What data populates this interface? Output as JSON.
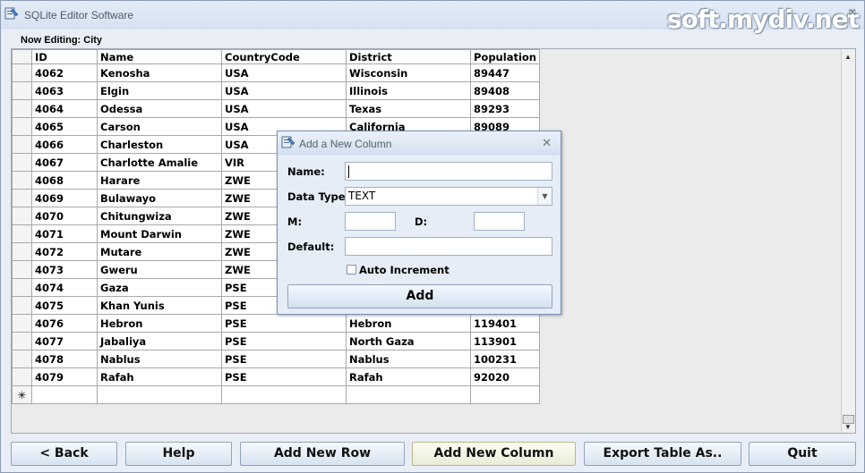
{
  "window": {
    "title": "SQLite Editor Software",
    "watermark": "soft.mydiv.net",
    "close_glyph": "✕",
    "title_icon": "app-icon"
  },
  "editing_label": "Now Editing: City",
  "table": {
    "columns": [
      "ID",
      "Name",
      "CountryCode",
      "District",
      "Population"
    ],
    "rows": [
      [
        "4062",
        "Kenosha",
        "USA",
        "Wisconsin",
        "89447"
      ],
      [
        "4063",
        "Elgin",
        "USA",
        "Illinois",
        "89408"
      ],
      [
        "4064",
        "Odessa",
        "USA",
        "Texas",
        "89293"
      ],
      [
        "4065",
        "Carson",
        "USA",
        "California",
        "89089"
      ],
      [
        "4066",
        "Charleston",
        "USA",
        "",
        ""
      ],
      [
        "4067",
        "Charlotte Amalie",
        "VIR",
        "",
        ""
      ],
      [
        "4068",
        "Harare",
        "ZWE",
        "",
        ""
      ],
      [
        "4069",
        "Bulawayo",
        "ZWE",
        "",
        ""
      ],
      [
        "4070",
        "Chitungwiza",
        "ZWE",
        "",
        ""
      ],
      [
        "4071",
        "Mount Darwin",
        "ZWE",
        "",
        ""
      ],
      [
        "4072",
        "Mutare",
        "ZWE",
        "",
        ""
      ],
      [
        "4073",
        "Gweru",
        "ZWE",
        "",
        ""
      ],
      [
        "4074",
        "Gaza",
        "PSE",
        "",
        ""
      ],
      [
        "4075",
        "Khan Yunis",
        "PSE",
        "",
        ""
      ],
      [
        "4076",
        "Hebron",
        "PSE",
        "Hebron",
        "119401"
      ],
      [
        "4077",
        "Jabaliya",
        "PSE",
        "North Gaza",
        "113901"
      ],
      [
        "4078",
        "Nablus",
        "PSE",
        "Nablus",
        "100231"
      ],
      [
        "4079",
        "Rafah",
        "PSE",
        "Rafah",
        "92020"
      ]
    ],
    "new_row_marker": "✳"
  },
  "buttons": {
    "back": "< Back",
    "help": "Help",
    "add_row": "Add New Row",
    "add_column": "Add New Column",
    "export": "Export Table As..",
    "quit": "Quit"
  },
  "dialog": {
    "title": "Add a New Column",
    "close_glyph": "✕",
    "name_label": "Name:",
    "name_value": "",
    "type_label": "Data Type:",
    "type_value": "TEXT",
    "m_label": "M:",
    "d_label": "D:",
    "default_label": "Default:",
    "auto_increment_label": "Auto Increment",
    "auto_increment_checked": false,
    "add_button": "Add"
  }
}
